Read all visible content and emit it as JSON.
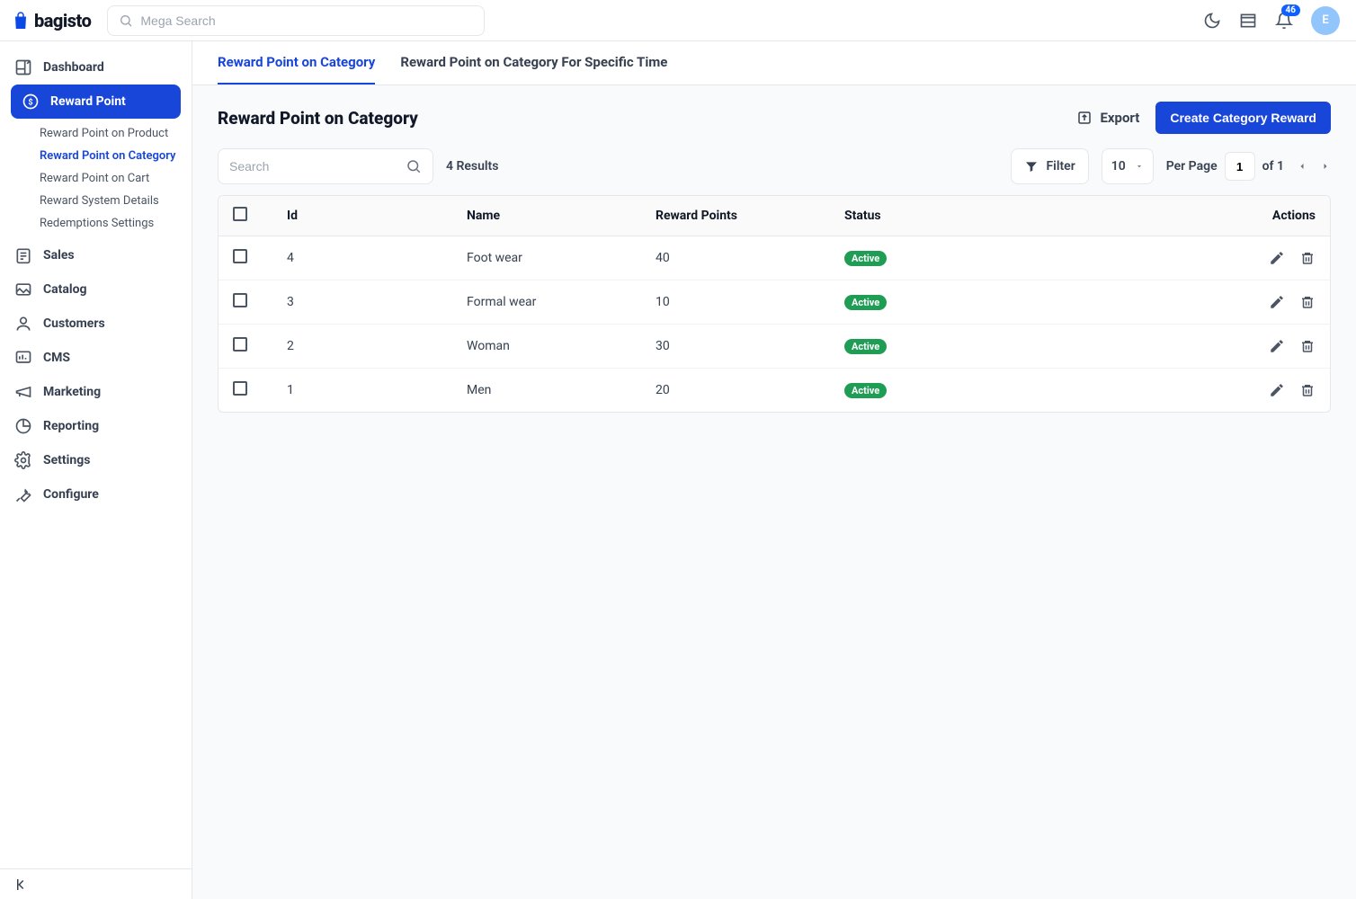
{
  "brand": {
    "name": "bagisto"
  },
  "topbar": {
    "search_placeholder": "Mega Search",
    "notification_count": "46",
    "avatar_initial": "E"
  },
  "sidebar": {
    "items": [
      {
        "key": "dashboard",
        "label": "Dashboard"
      },
      {
        "key": "reward",
        "label": "Reward Point",
        "active": true
      },
      {
        "key": "sales",
        "label": "Sales"
      },
      {
        "key": "catalog",
        "label": "Catalog"
      },
      {
        "key": "customers",
        "label": "Customers"
      },
      {
        "key": "cms",
        "label": "CMS"
      },
      {
        "key": "marketing",
        "label": "Marketing"
      },
      {
        "key": "reporting",
        "label": "Reporting"
      },
      {
        "key": "settings",
        "label": "Settings"
      },
      {
        "key": "configure",
        "label": "Configure"
      }
    ],
    "reward_sub": [
      {
        "key": "product",
        "label": "Reward Point on Product"
      },
      {
        "key": "category",
        "label": "Reward Point on Category",
        "active": true
      },
      {
        "key": "cart",
        "label": "Reward Point on Cart"
      },
      {
        "key": "details",
        "label": "Reward System Details"
      },
      {
        "key": "redeem",
        "label": "Redemptions Settings"
      }
    ]
  },
  "tabs": [
    {
      "key": "cat",
      "label": "Reward Point on Category",
      "active": true
    },
    {
      "key": "cat-time",
      "label": "Reward Point on Category For Specific Time"
    }
  ],
  "page": {
    "title": "Reward Point on Category",
    "export_label": "Export",
    "create_label": "Create Category Reward"
  },
  "toolbar": {
    "search_placeholder": "Search",
    "results_text": "4 Results",
    "filter_label": "Filter",
    "per_page_value": "10",
    "per_page_label": "Per Page",
    "page_current": "1",
    "page_total_text": "of 1"
  },
  "table": {
    "columns": {
      "id": "Id",
      "name": "Name",
      "points": "Reward Points",
      "status": "Status",
      "actions": "Actions"
    },
    "rows": [
      {
        "id": "4",
        "name": "Foot wear",
        "points": "40",
        "status": "Active"
      },
      {
        "id": "3",
        "name": "Formal wear",
        "points": "10",
        "status": "Active"
      },
      {
        "id": "2",
        "name": "Woman",
        "points": "30",
        "status": "Active"
      },
      {
        "id": "1",
        "name": "Men",
        "points": "20",
        "status": "Active"
      }
    ]
  }
}
